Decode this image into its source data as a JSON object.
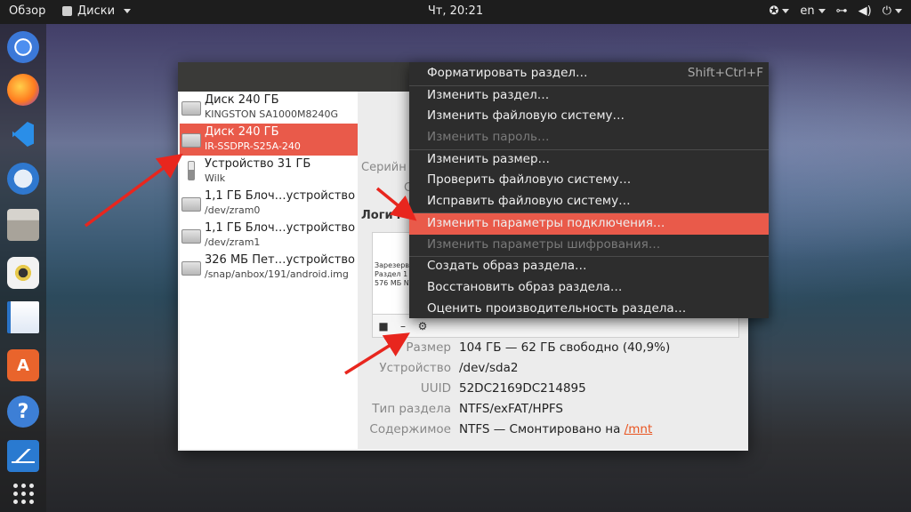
{
  "topbar": {
    "activities": "Обзор",
    "app_name": "Диски",
    "clock": "Чт, 20:21",
    "language": "en",
    "accessibility_icon": "accessibility-icon",
    "network_icon": "network-icon",
    "volume_icon": "volume-icon",
    "power_icon": "power-icon"
  },
  "dock": {
    "items": [
      "chrome-icon",
      "firefox-icon",
      "vscode-icon",
      "thunderbird-icon",
      "files-icon",
      "rhythmbox-icon",
      "writer-icon",
      "software-icon",
      "help-icon",
      "monitor-icon",
      "show-apps-icon"
    ],
    "store_glyph": "A",
    "help_glyph": "?"
  },
  "devices": [
    {
      "name": "Диск 240 ГБ",
      "sub": "KINGSTON SA1000M8240G"
    },
    {
      "name": "Диск 240 ГБ",
      "sub": "IR-SSDPR-S25A-240"
    },
    {
      "name": "Устройство 31 ГБ",
      "sub": "Wilk"
    },
    {
      "name": "1,1 ГБ Блоч…устройство",
      "sub": "/dev/zram0"
    },
    {
      "name": "1,1 ГБ Блоч…устройство",
      "sub": "/dev/zram1"
    },
    {
      "name": "326 МБ Пет…устройство",
      "sub": "/snap/anbox/191/android.img"
    }
  ],
  "content": {
    "serial_label": "Серийн",
    "stub_label": "С",
    "volumes_title": "Логич",
    "volume_part": {
      "line1": "Зарезерв…",
      "line2": "Раздел 1",
      "line3": "576 МБ NT…"
    },
    "toolbar": {
      "stop": "■",
      "minus": "–",
      "gear": "⚙"
    },
    "props": [
      {
        "key": "Размер",
        "value": "104 ГБ — 62 ГБ свободно (40,9%)"
      },
      {
        "key": "Устройство",
        "value": "/dev/sda2"
      },
      {
        "key": "UUID",
        "value": "52DC2169DC214895"
      },
      {
        "key": "Тип раздела",
        "value": "NTFS/exFAT/HPFS"
      }
    ],
    "contents_key": "Содержимое",
    "contents_value": "NTFS — Смонтировано на ",
    "contents_link": "/mnt"
  },
  "menu": {
    "items": [
      {
        "label": "Форматировать раздел…",
        "accel": "Shift+Ctrl+F"
      },
      {
        "label": "Изменить раздел…"
      },
      {
        "label": "Изменить файловую систему…"
      },
      {
        "label": "Изменить пароль…"
      },
      {
        "label": "Изменить размер…"
      },
      {
        "label": "Проверить файловую систему…"
      },
      {
        "label": "Исправить файловую систему…"
      },
      {
        "label": "Изменить параметры подключения…"
      },
      {
        "label": "Изменить параметры шифрования…"
      },
      {
        "label": "Создать образ раздела…"
      },
      {
        "label": "Восстановить образ раздела…"
      },
      {
        "label": "Оценить производительность раздела…"
      }
    ]
  },
  "colors": {
    "accent": "#e95a4a",
    "arrow": "#e8261e",
    "menu_bg": "#2d2d2d",
    "topbar_bg": "#1d1d1d"
  }
}
